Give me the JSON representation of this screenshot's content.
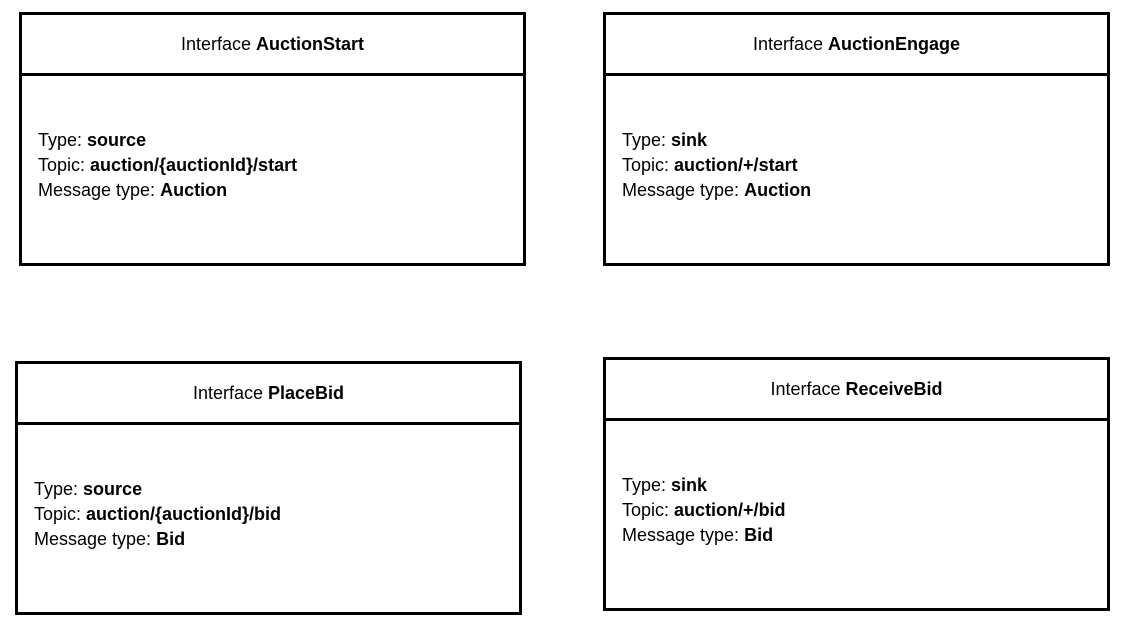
{
  "interfaces": [
    {
      "prefix": "Interface",
      "name": "AuctionStart",
      "type_label": "Type:",
      "type": "source",
      "topic_label": "Topic:",
      "topic": "auction/{auctionId}/start",
      "msg_label": "Message type:",
      "msg": "Auction"
    },
    {
      "prefix": "Interface",
      "name": "AuctionEngage",
      "type_label": "Type:",
      "type": "sink",
      "topic_label": "Topic:",
      "topic": "auction/+/start",
      "msg_label": "Message type:",
      "msg": "Auction"
    },
    {
      "prefix": "Interface",
      "name": "PlaceBid",
      "type_label": "Type:",
      "type": "source",
      "topic_label": "Topic:",
      "topic": "auction/{auctionId}/bid",
      "msg_label": "Message type:",
      "msg": "Bid"
    },
    {
      "prefix": "Interface",
      "name": "ReceiveBid",
      "type_label": "Type:",
      "type": "sink",
      "topic_label": "Topic:",
      "topic": "auction/+/bid",
      "msg_label": "Message type:",
      "msg": "Bid"
    }
  ]
}
